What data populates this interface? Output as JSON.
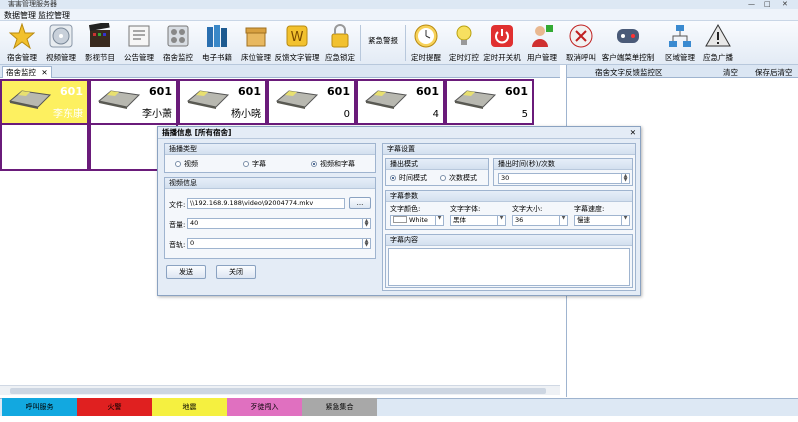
{
  "window": {
    "title": "害害管理服务器"
  },
  "menu": [
    "数据管理",
    "监控管理"
  ],
  "toolbar": [
    {
      "label": "宿舍管理",
      "icon": "star-icon"
    },
    {
      "label": "视频管理",
      "icon": "disc-icon"
    },
    {
      "label": "影视节目",
      "icon": "film-icon"
    },
    {
      "label": "公告管理",
      "icon": "notice-icon"
    },
    {
      "label": "宿舍监控",
      "icon": "monitor-icon"
    },
    {
      "label": "电子书籍",
      "icon": "books-icon"
    },
    {
      "label": "床位管理",
      "icon": "box-icon"
    },
    {
      "label": "反馈文字管理",
      "icon": "text-icon"
    },
    {
      "label": "应急锁定",
      "icon": "lock-icon"
    },
    {
      "label": "紧急警报",
      "icon": "dropdown-icon"
    },
    {
      "label": "定时提醒",
      "icon": "clock-icon"
    },
    {
      "label": "定时灯控",
      "icon": "bulb-icon"
    },
    {
      "label": "定时开关机",
      "icon": "power-icon"
    },
    {
      "label": "用户管理",
      "icon": "user-icon"
    },
    {
      "label": "取消呼叫",
      "icon": "cancel-call-icon"
    },
    {
      "label": "客户端菜单控制",
      "icon": "gamepad-icon"
    },
    {
      "label": "区域管理",
      "icon": "network-icon"
    },
    {
      "label": "应急广播",
      "icon": "warning-icon"
    }
  ],
  "tab": {
    "label": "宿舍监控"
  },
  "right_panel": {
    "title": "宿舍文字反馈监控区",
    "clear_btn": "清空",
    "save_clear_btn": "保存后清空"
  },
  "rooms": [
    {
      "num": "601",
      "name": "李东康",
      "highlight": true
    },
    {
      "num": "601",
      "name": "李小萧",
      "highlight": false
    },
    {
      "num": "601",
      "name": "杨小晓",
      "highlight": false
    },
    {
      "num": "601",
      "name": "0",
      "highlight": false
    },
    {
      "num": "601",
      "name": "4",
      "highlight": false
    },
    {
      "num": "601",
      "name": "5",
      "highlight": false
    }
  ],
  "dialog": {
    "title": "插播信息  [所有宿舍]",
    "type_group": "插播类型",
    "type_options": [
      "视频",
      "字幕",
      "视频和字幕"
    ],
    "video_group": "视频信息",
    "file_label": "文件:",
    "file_value": "\\\\192.168.9.188\\video\\92004774.mkv",
    "browse": "...",
    "volume_label": "音量:",
    "volume_value": "40",
    "track_label": "音轨:",
    "track_value": "0",
    "send_btn": "发送",
    "close_btn": "关闭",
    "subtitle_group": "字幕设置",
    "mode_group": "播出模式",
    "mode_options": [
      "时间模式",
      "次数模式"
    ],
    "duration_group": "播出时间(秒)/次数",
    "duration_value": "30",
    "params_group": "字幕参数",
    "color_label": "文字颜色:",
    "color_value": "White",
    "font_label": "文字字体:",
    "font_value": "黑体",
    "size_label": "文字大小:",
    "size_value": "36",
    "speed_label": "字幕速度:",
    "speed_value": "慢速",
    "content_group": "字幕内容"
  },
  "alarms": [
    {
      "label": "呼叫服务",
      "color": "#12a8e0"
    },
    {
      "label": "火警",
      "color": "#e02020"
    },
    {
      "label": "地震",
      "color": "#f5f040"
    },
    {
      "label": "歹徒闯入",
      "color": "#e070c0"
    },
    {
      "label": "紧急集合",
      "color": "#a8a8a8"
    }
  ]
}
